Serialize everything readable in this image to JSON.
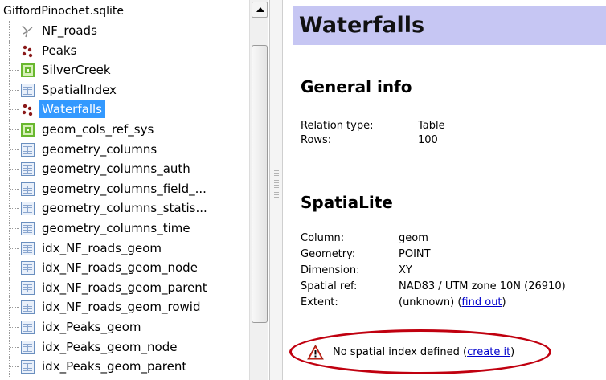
{
  "tree": {
    "root_label": "GiffordPinochet.sqlite",
    "items": [
      {
        "label": "NF_roads",
        "icon": "line-layer-icon"
      },
      {
        "label": "Peaks",
        "icon": "point-layer-icon"
      },
      {
        "label": "SilverCreek",
        "icon": "polygon-layer-icon"
      },
      {
        "label": "SpatialIndex",
        "icon": "table-icon"
      },
      {
        "label": "Waterfalls",
        "icon": "point-layer-icon",
        "selected": true
      },
      {
        "label": "geom_cols_ref_sys",
        "icon": "polygon-layer-icon"
      },
      {
        "label": "geometry_columns",
        "icon": "table-icon"
      },
      {
        "label": "geometry_columns_auth",
        "icon": "table-icon"
      },
      {
        "label": "geometry_columns_field_...",
        "icon": "table-icon"
      },
      {
        "label": "geometry_columns_statis...",
        "icon": "table-icon"
      },
      {
        "label": "geometry_columns_time",
        "icon": "table-icon"
      },
      {
        "label": "idx_NF_roads_geom",
        "icon": "table-icon"
      },
      {
        "label": "idx_NF_roads_geom_node",
        "icon": "table-icon"
      },
      {
        "label": "idx_NF_roads_geom_parent",
        "icon": "table-icon"
      },
      {
        "label": "idx_NF_roads_geom_rowid",
        "icon": "table-icon"
      },
      {
        "label": "idx_Peaks_geom",
        "icon": "table-icon"
      },
      {
        "label": "idx_Peaks_geom_node",
        "icon": "table-icon"
      },
      {
        "label": "idx_Peaks_geom_parent",
        "icon": "table-icon"
      }
    ]
  },
  "info": {
    "title": "Waterfalls",
    "general": {
      "heading": "General info",
      "relation_type_label": "Relation type:",
      "relation_type_value": "Table",
      "rows_label": "Rows:",
      "rows_value": "100"
    },
    "spatialite": {
      "heading": "SpatiaLite",
      "column_label": "Column:",
      "column_value": "geom",
      "geometry_label": "Geometry:",
      "geometry_value": "POINT",
      "dimension_label": "Dimension:",
      "dimension_value": "XY",
      "spatial_ref_label": "Spatial ref:",
      "spatial_ref_value": "NAD83 / UTM zone 10N (26910)",
      "extent_label": "Extent:",
      "extent_value": "(unknown) (",
      "extent_link": "find out",
      "extent_close": ")"
    },
    "warning": {
      "text": "No spatial index defined (",
      "link": "create it",
      "close": ")"
    }
  },
  "colors": {
    "selection": "#3399ff",
    "title_bar": "#c6c6f3",
    "warning_oval": "#c0000f",
    "link": "#0000cc"
  }
}
